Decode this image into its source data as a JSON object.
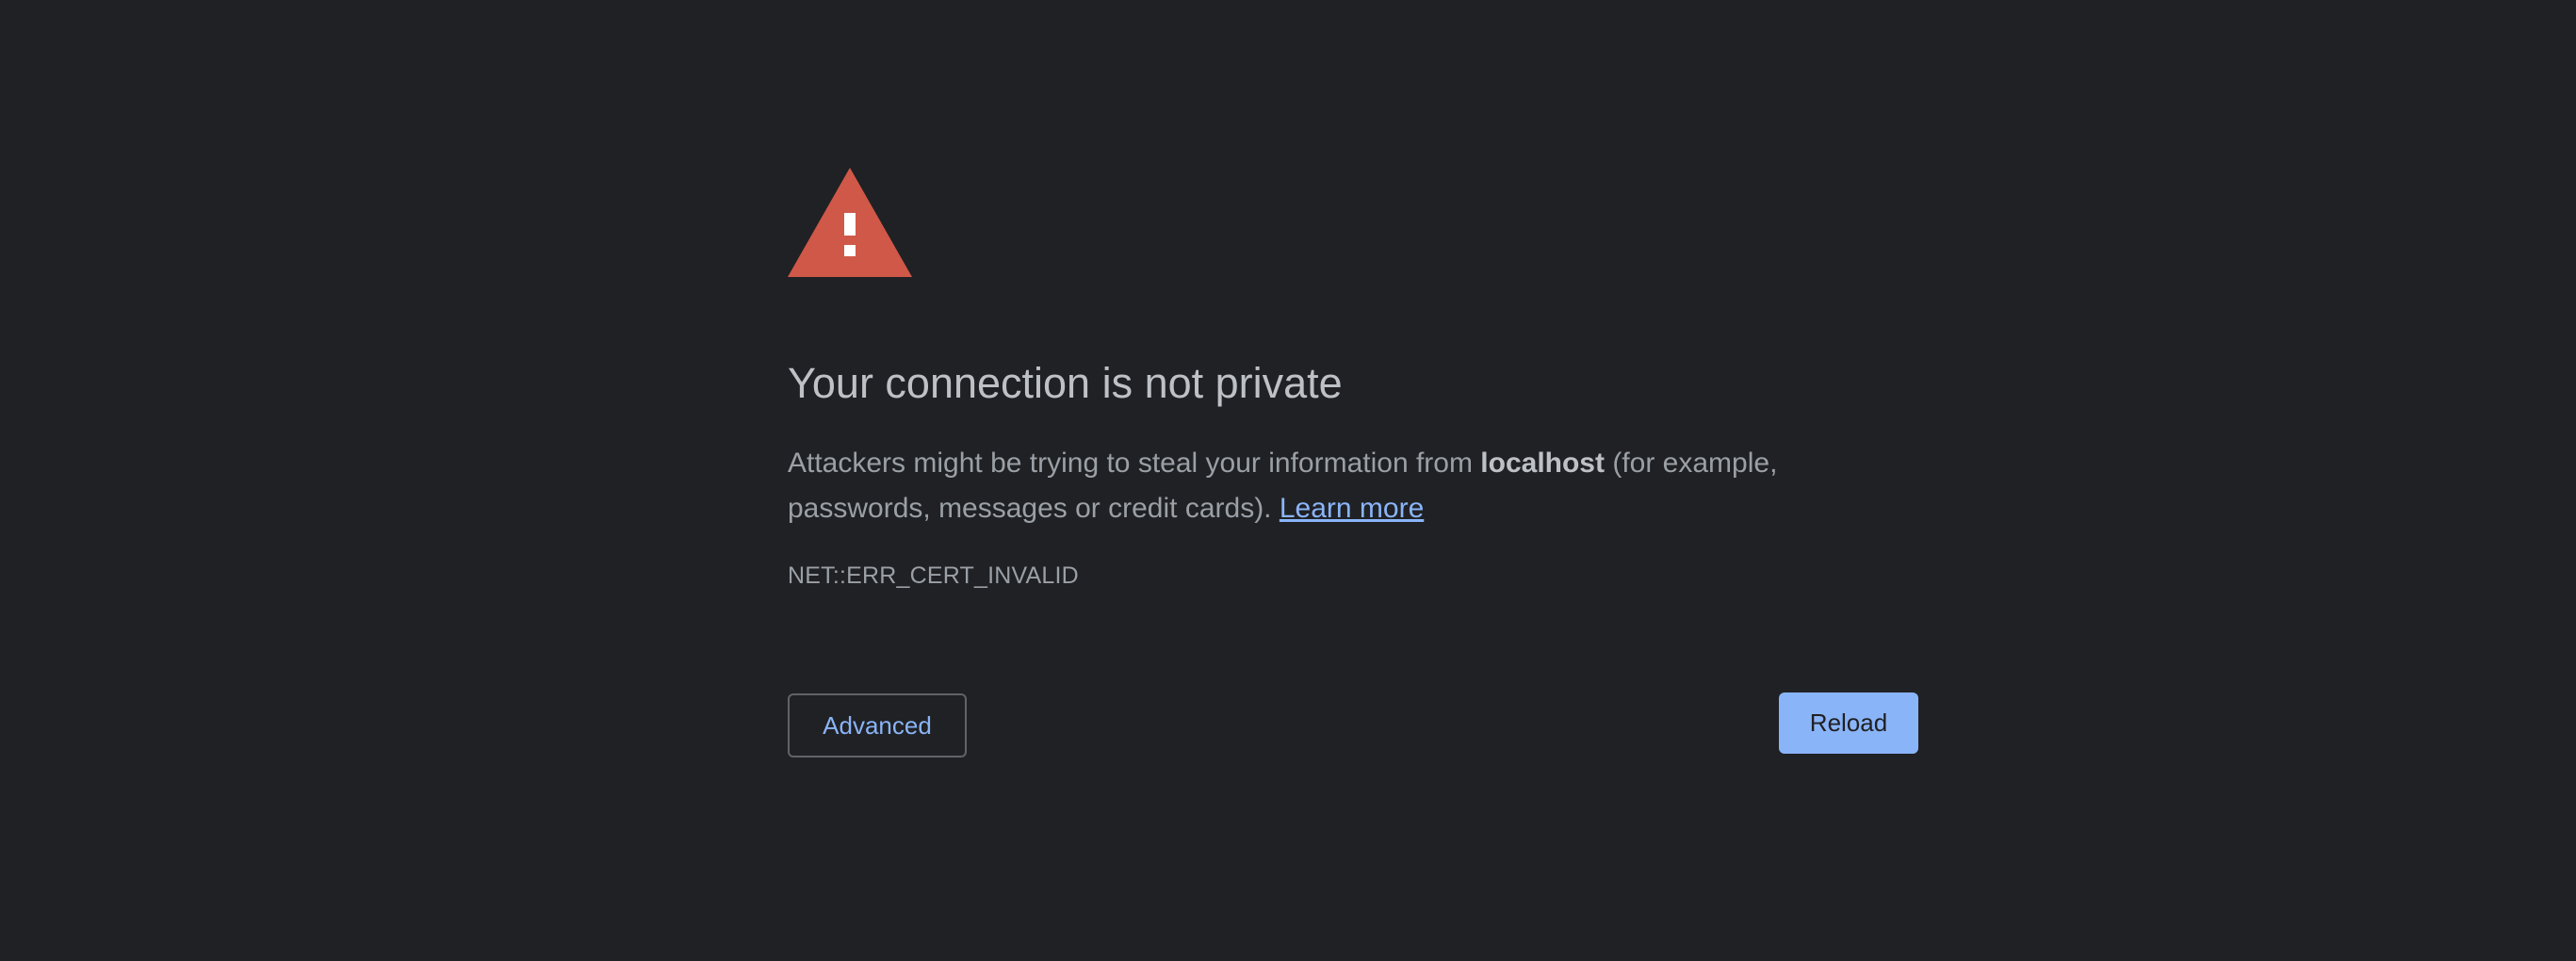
{
  "interstitial": {
    "headline": "Your connection is not private",
    "explanation": {
      "prefix": "Attackers might be trying to steal your information from ",
      "host": "localhost",
      "suffix": " (for example, passwords, messages or credit cards). ",
      "learn_more": "Learn more"
    },
    "error_code": "NET::ERR_CERT_INVALID"
  },
  "buttons": {
    "advanced": "Advanced",
    "reload": "Reload"
  },
  "colors": {
    "background": "#202124",
    "warning_icon": "#d05848",
    "accent": "#8ab4f8"
  },
  "icons": {
    "warning": "warning-triangle-icon"
  }
}
